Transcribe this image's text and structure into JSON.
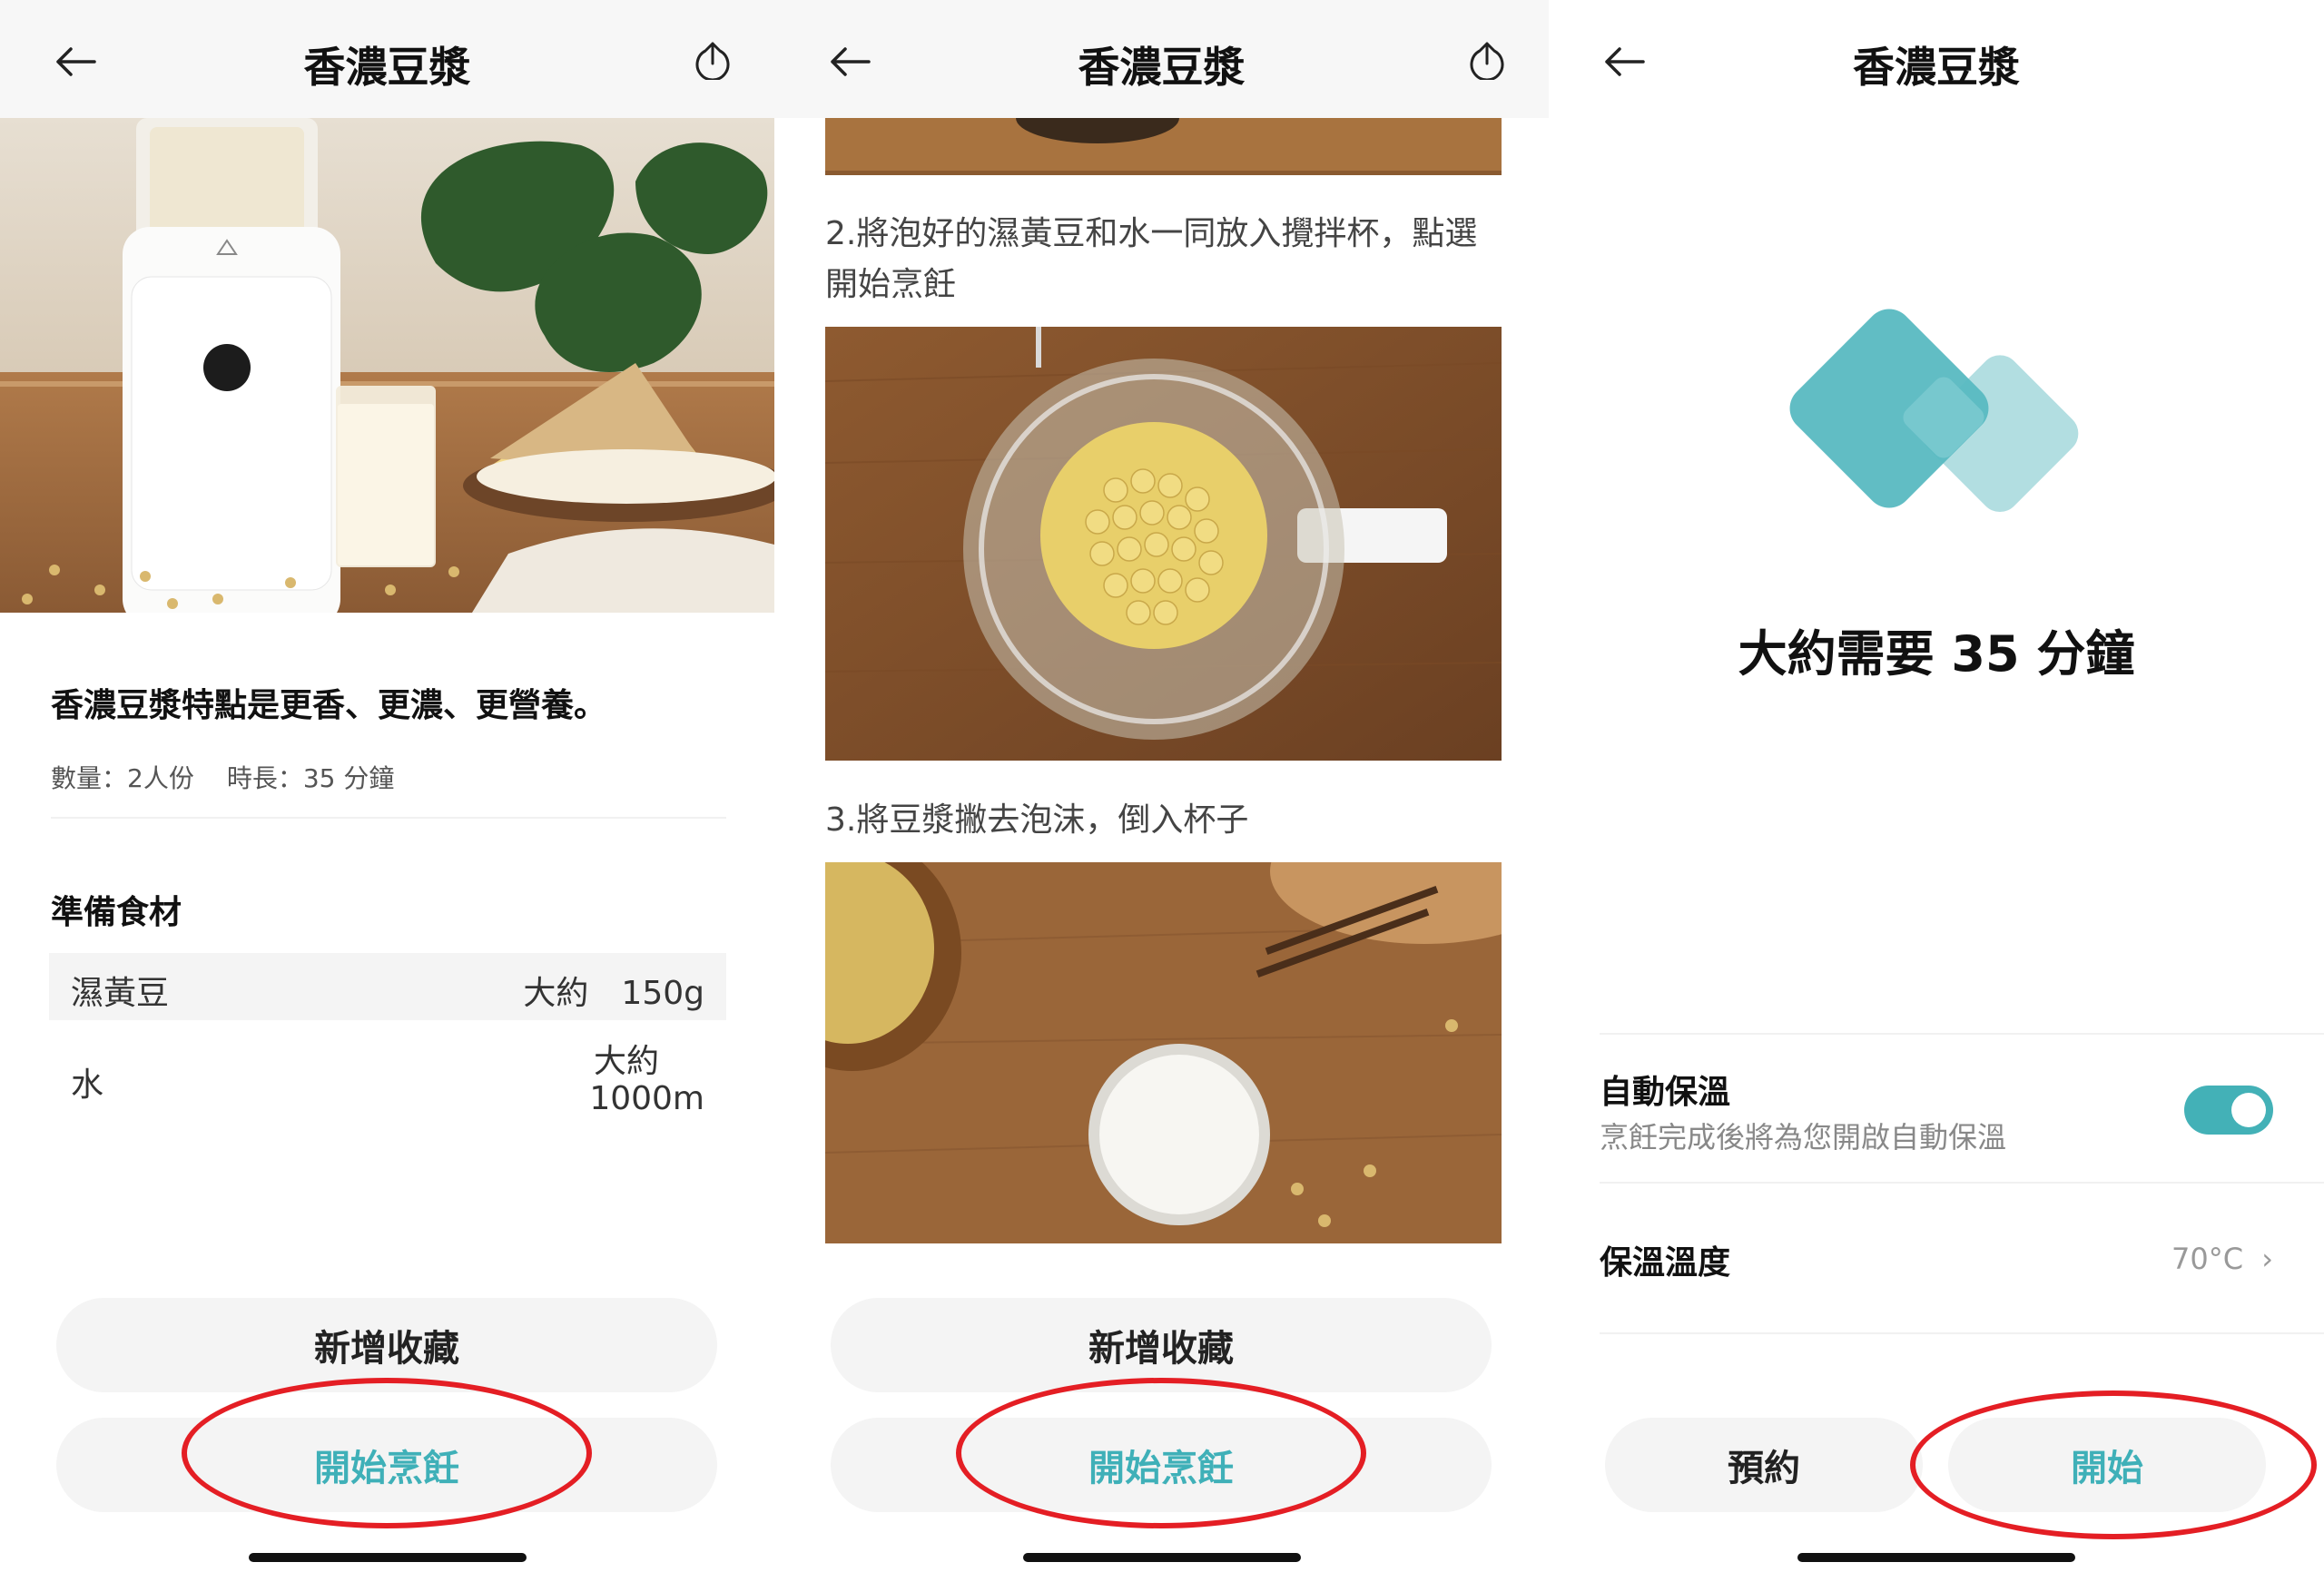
{
  "screen1": {
    "title": "香濃豆漿",
    "description": "香濃豆漿特點是更香、更濃、更營養。",
    "servings": "數量：2人份",
    "duration": "時長：35 分鐘",
    "ingredients_heading": "準備食材",
    "ingredients": [
      {
        "name": "濕黃豆",
        "amount": "大約　150g"
      },
      {
        "name": "水",
        "amount_line1": "大約",
        "amount_line2": "1000m"
      }
    ],
    "favorite_label": "新增收藏",
    "start_label": "開始烹飪"
  },
  "screen2": {
    "title": "香濃豆漿",
    "step2": "2.將泡好的濕黃豆和水一同放入攪拌杯，點選開始烹飪",
    "step3": "3.將豆漿撇去泡沫，倒入杯子",
    "favorite_label": "新增收藏",
    "start_label": "開始烹飪"
  },
  "screen3": {
    "title": "香濃豆漿",
    "time_text": "大約需要 35 分鐘",
    "keep_warm_label": "自動保溫",
    "keep_warm_sub": "烹飪完成後將為您開啟自動保溫",
    "keep_warm_on": true,
    "temp_label": "保溫溫度",
    "temp_value": "70°C",
    "schedule_label": "預約",
    "start_label": "開始"
  },
  "colors": {
    "accent": "#43b1b7",
    "highlight_ring": "#e41e24",
    "button_bg": "#f4f4f4"
  }
}
